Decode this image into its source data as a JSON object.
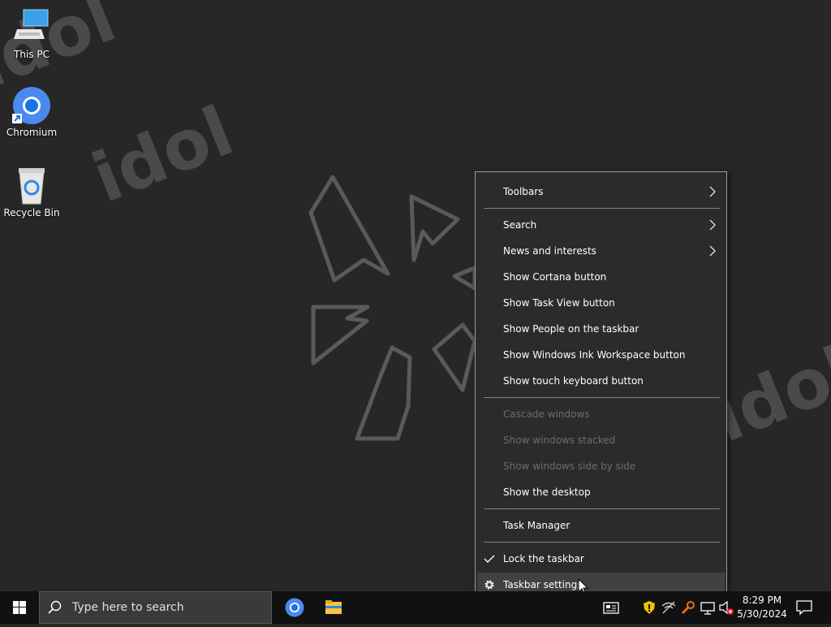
{
  "desktop": {
    "icons": [
      {
        "label": "This PC"
      },
      {
        "label": "Chromium"
      },
      {
        "label": "Recycle Bin"
      }
    ],
    "watermark": "idol"
  },
  "context_menu": {
    "items": [
      {
        "label": "Toolbars",
        "submenu": true,
        "enabled": true
      },
      {
        "label": "Search",
        "submenu": true,
        "enabled": true
      },
      {
        "label": "News and interests",
        "submenu": true,
        "enabled": true
      },
      {
        "label": "Show Cortana button",
        "enabled": true
      },
      {
        "label": "Show Task View button",
        "enabled": true
      },
      {
        "label": "Show People on the taskbar",
        "enabled": true
      },
      {
        "label": "Show Windows Ink Workspace button",
        "enabled": true
      },
      {
        "label": "Show touch keyboard button",
        "enabled": true
      },
      {
        "label": "Cascade windows",
        "enabled": false
      },
      {
        "label": "Show windows stacked",
        "enabled": false
      },
      {
        "label": "Show windows side by side",
        "enabled": false
      },
      {
        "label": "Show the desktop",
        "enabled": true
      },
      {
        "label": "Task Manager",
        "enabled": true
      },
      {
        "label": "Lock the taskbar",
        "enabled": true,
        "checked": true
      },
      {
        "label": "Taskbar settings",
        "enabled": true,
        "icon": "gear-icon",
        "hovered": true
      }
    ]
  },
  "taskbar": {
    "search_placeholder": "Type here to search",
    "pinned": [
      "chromium-icon",
      "file-explorer-icon"
    ],
    "tray_icons": [
      "news-icon",
      "warning-shield-icon",
      "network-icon",
      "tools-icon",
      "display-icon",
      "volume-muted-icon"
    ],
    "clock": {
      "time": "8:29 PM",
      "date": "5/30/2024"
    }
  },
  "colors": {
    "desktop_bg": "#272727",
    "menu_bg": "#2b2b2b",
    "menu_hover": "#414141",
    "taskbar_bg": "#111111",
    "disabled_text": "#6d6d6d"
  }
}
